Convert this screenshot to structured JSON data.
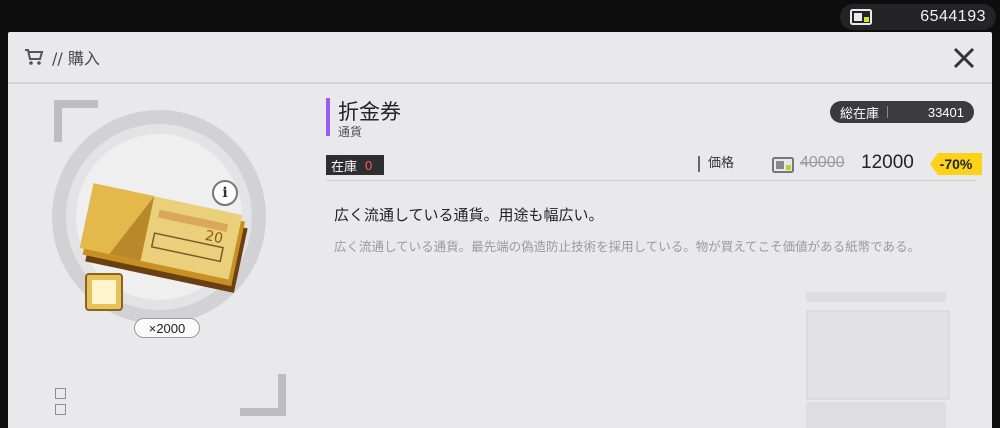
{
  "topbar": {
    "currency_icon": "money-card-icon",
    "currency_value": "6544193"
  },
  "header": {
    "cart_icon": "cart-icon",
    "title": "// 購入",
    "close_icon": "close-icon"
  },
  "item": {
    "name": "折金券",
    "type": "通貨",
    "accent_color": "#9a5cf0",
    "quantity_label": "×2000",
    "info_icon": "info-icon",
    "total_stock_label": "総在庫",
    "total_stock_value": "33401",
    "stock_label": "在庫",
    "stock_value": "0",
    "price_label": "価格",
    "price_icon": "money-card-icon",
    "old_price": "40000",
    "new_price": "12000",
    "discount": "-70%",
    "discount_color": "#ffd21a",
    "description_main": "広く流通している通貨。用途も幅広い。",
    "description_detail": "広く流通している通貨。最先端の偽造防止技術を採用している。物が買えてこそ価値がある紙幣である。"
  }
}
